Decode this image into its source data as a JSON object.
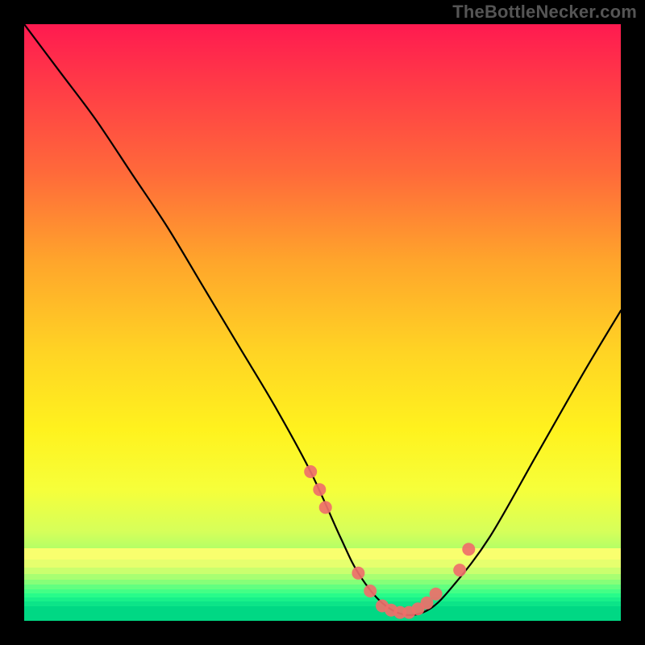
{
  "attribution": "TheBottleNecker.com",
  "chart_data": {
    "type": "line",
    "title": "",
    "xlabel": "",
    "ylabel": "",
    "xlim": [
      0,
      100
    ],
    "ylim": [
      0,
      100
    ],
    "series": [
      {
        "name": "bottleneck-curve",
        "x": [
          0,
          6,
          12,
          18,
          24,
          30,
          36,
          42,
          48,
          53,
          56,
          60,
          64,
          68,
          72,
          78,
          86,
          94,
          100
        ],
        "y": [
          100,
          92,
          84,
          75,
          66,
          56,
          46,
          36,
          25,
          14,
          8,
          3,
          1,
          2,
          6,
          14,
          28,
          42,
          52
        ]
      }
    ],
    "highlight_points": {
      "name": "sample-dots",
      "x": [
        48,
        49.5,
        50.5,
        56,
        58,
        60,
        61.5,
        63,
        64.5,
        66,
        67.5,
        69,
        73,
        74.5
      ],
      "y": [
        25,
        22,
        19,
        8,
        5,
        2.5,
        1.8,
        1.4,
        1.4,
        2,
        3,
        4.5,
        8.5,
        12
      ]
    },
    "background_gradient": {
      "top": "#ff1a50",
      "mid": "#ffe22a",
      "bottom": "#00d884"
    }
  }
}
